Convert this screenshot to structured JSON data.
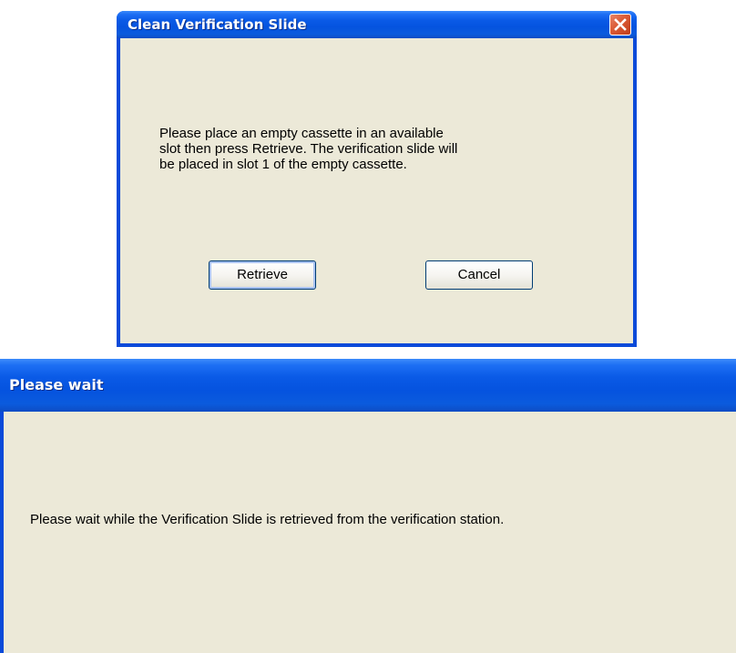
{
  "dialog_clean": {
    "title": "Clean Verification Slide",
    "message_lines": [
      "Please place an empty cassette in an available",
      "slot then press Retrieve.  The verification slide will",
      "be placed in slot 1 of the empty cassette."
    ],
    "buttons": {
      "retrieve_label": "Retrieve",
      "cancel_label": "Cancel"
    },
    "close_icon": "close-icon"
  },
  "dialog_wait": {
    "title": "Please wait",
    "message": "Please wait while the Verification Slide is retrieved from the verification station."
  },
  "colors": {
    "titlebar_blue": "#0553df",
    "frame_blue": "#0a4ad9",
    "client_beige": "#ece9d8",
    "close_red": "#da5a34"
  }
}
